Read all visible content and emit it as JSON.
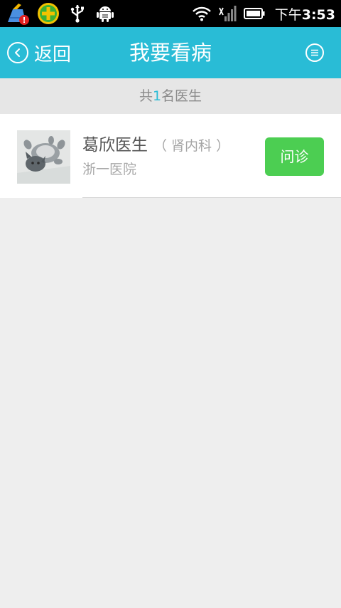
{
  "status_bar": {
    "time_prefix": "下午",
    "time": "3:53",
    "icons": [
      "broom-icon",
      "plus-icon",
      "usb-icon",
      "android-icon",
      "wifi-icon",
      "signal-icon",
      "battery-icon"
    ]
  },
  "header": {
    "back_label": "返回",
    "title": "我要看病",
    "accent_color": "#29bcd6"
  },
  "summary": {
    "prefix": "共",
    "count": "1",
    "suffix": "名医生"
  },
  "doctors": [
    {
      "name": "葛欣医生",
      "department": "（ 肾内科 ）",
      "hospital": "浙一医院",
      "action_label": "问诊",
      "action_color": "#4cce52"
    }
  ]
}
